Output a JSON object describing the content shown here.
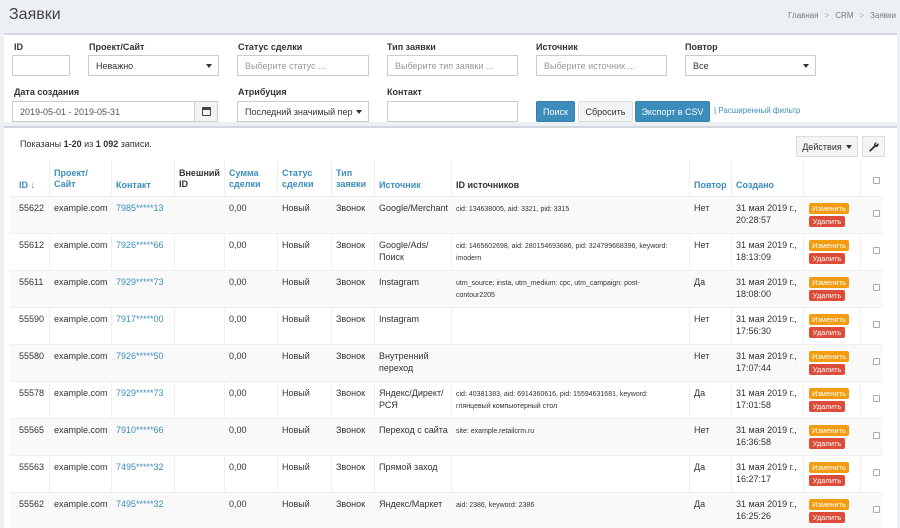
{
  "header": {
    "title": "Заявки",
    "breadcrumb": [
      "Главная",
      "CRM",
      "Заявки"
    ]
  },
  "filters": {
    "id": {
      "label": "ID",
      "value": ""
    },
    "project": {
      "label": "Проект/Сайт",
      "value": "Неважно"
    },
    "deal_status": {
      "label": "Статус сделки",
      "placeholder": "Выберите статус ..."
    },
    "request_type": {
      "label": "Тип заявки",
      "placeholder": "Выберите тип заявки ..."
    },
    "source": {
      "label": "Источник",
      "placeholder": "Выберите источник ..."
    },
    "repeat": {
      "label": "Повтор",
      "value": "Все"
    },
    "created": {
      "label": "Дата создания",
      "value": "2019-05-01 - 2019-05-31"
    },
    "attribution": {
      "label": "Атрибуция",
      "value": "Последний значимый пер"
    },
    "contact": {
      "label": "Контакт",
      "value": ""
    },
    "buttons": {
      "search": "Поиск",
      "reset": "Сбросить",
      "export": "Экспорт в CSV"
    },
    "advanced_link": "Расширенный фильтр"
  },
  "table": {
    "summary": {
      "prefix": "Показаны ",
      "range": "1-20",
      "mid": " из ",
      "total": "1 092",
      "suffix": " записи."
    },
    "actions_label": "Действия",
    "columns": {
      "id": "ID",
      "project": [
        "Проект/",
        "Сайт"
      ],
      "contact": "Контакт",
      "external_id": [
        "Внешний",
        "ID"
      ],
      "amount": [
        "Сумма",
        "сделки"
      ],
      "status": [
        "Статус",
        "сделки"
      ],
      "type": [
        "Тип",
        "заявки"
      ],
      "source": "Источник",
      "source_ids": "ID источников",
      "repeat": "Повтор",
      "created": "Создано"
    },
    "edit_label": "Изменить",
    "delete_label": "Удалить",
    "rows": [
      {
        "id": "55622",
        "project": "example.com",
        "contact": "7985*****13",
        "amount": "0,00",
        "status": "Новый",
        "type": "Звонок",
        "source": [
          "Google/Merchant"
        ],
        "source_ids": [
          "cid: 134638005, aid: 3321, pid: 3315"
        ],
        "repeat": "Нет",
        "created": [
          "31 мая 2019 г.,",
          "20:28:57"
        ]
      },
      {
        "id": "55612",
        "project": "example.com",
        "contact": "7926*****66",
        "amount": "0,00",
        "status": "Новый",
        "type": "Звонок",
        "source": [
          "Google/Ads/",
          "Поиск"
        ],
        "source_ids": [
          "cid: 1465602698, aid: 280154693686, pid: 324799668396, keyword:",
          "imodern"
        ],
        "repeat": "Нет",
        "created": [
          "31 мая 2019 г.,",
          "18:13:09"
        ]
      },
      {
        "id": "55611",
        "project": "example.com",
        "contact": "7929*****73",
        "amount": "0,00",
        "status": "Новый",
        "type": "Звонок",
        "source": [
          "Instagram"
        ],
        "source_ids": [
          "utm_source: insta, utm_medium: cpc, utm_campaign: post-",
          "contour2205"
        ],
        "repeat": "Да",
        "created": [
          "31 мая 2019 г.,",
          "18:08:00"
        ]
      },
      {
        "id": "55590",
        "project": "example.com",
        "contact": "7917*****00",
        "amount": "0,00",
        "status": "Новый",
        "type": "Звонок",
        "source": [
          "Instagram"
        ],
        "source_ids": [],
        "repeat": "Нет",
        "created": [
          "31 мая 2019 г.,",
          "17:56:30"
        ]
      },
      {
        "id": "55580",
        "project": "example.com",
        "contact": "7926*****50",
        "amount": "0,00",
        "status": "Новый",
        "type": "Звонок",
        "source": [
          "Внутренний",
          "переход"
        ],
        "source_ids": [],
        "repeat": "Нет",
        "created": [
          "31 мая 2019 г.,",
          "17:07:44"
        ]
      },
      {
        "id": "55578",
        "project": "example.com",
        "contact": "7929*****73",
        "amount": "0,00",
        "status": "Новый",
        "type": "Звонок",
        "source": [
          "Яндекс/Директ/",
          "РСЯ"
        ],
        "source_ids": [
          "cid: 40381383, aid: 6914360616, pid: 15594631681, keyword:",
          "глянцевый компьютерный стол"
        ],
        "repeat": "Да",
        "created": [
          "31 мая 2019 г.,",
          "17:01:58"
        ]
      },
      {
        "id": "55565",
        "project": "example.com",
        "contact": "7910*****66",
        "amount": "0,00",
        "status": "Новый",
        "type": "Звонок",
        "source": [
          "Переход с сайта"
        ],
        "source_ids": [
          "site: example.retailcrm.ru"
        ],
        "repeat": "Нет",
        "created": [
          "31 мая 2019 г.,",
          "16:36:58"
        ]
      },
      {
        "id": "55563",
        "project": "example.com",
        "contact": "7495*****32",
        "amount": "0,00",
        "status": "Новый",
        "type": "Звонок",
        "source": [
          "Прямой заход"
        ],
        "source_ids": [],
        "repeat": "Да",
        "created": [
          "31 мая 2019 г.,",
          "16:27:17"
        ]
      },
      {
        "id": "55562",
        "project": "example.com",
        "contact": "7495*****32",
        "amount": "0,00",
        "status": "Новый",
        "type": "Звонок",
        "source": [
          "Яндекс/Маркет"
        ],
        "source_ids": [
          "aid: 2386, keyword: 2386"
        ],
        "repeat": "Да",
        "created": [
          "31 мая 2019 г.,",
          "16:25:26"
        ]
      }
    ]
  }
}
